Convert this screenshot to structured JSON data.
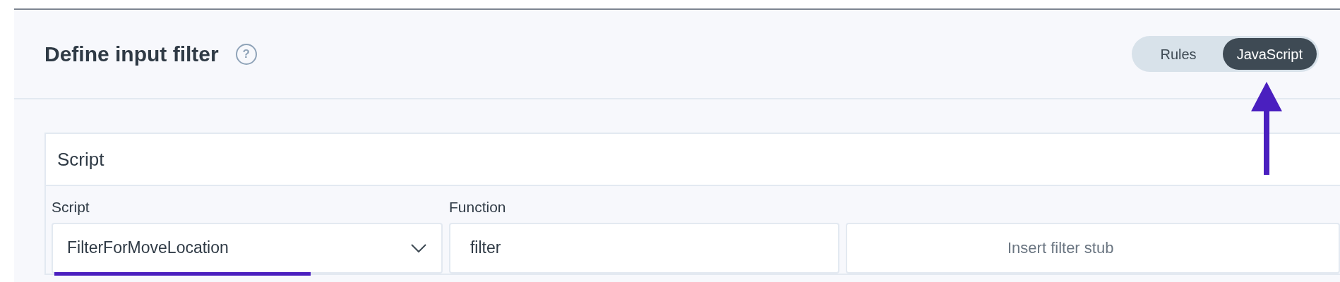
{
  "header": {
    "title": "Define input filter",
    "help": "?"
  },
  "mode_toggle": [
    {
      "label": "Rules",
      "selected": false
    },
    {
      "label": "JavaScript",
      "selected": true
    }
  ],
  "card": {
    "title": "Script",
    "script_field": {
      "label": "Script",
      "value": "FilterForMoveLocation"
    },
    "function_field": {
      "label": "Function",
      "value": "filter"
    },
    "button": "Insert filter stub"
  }
}
